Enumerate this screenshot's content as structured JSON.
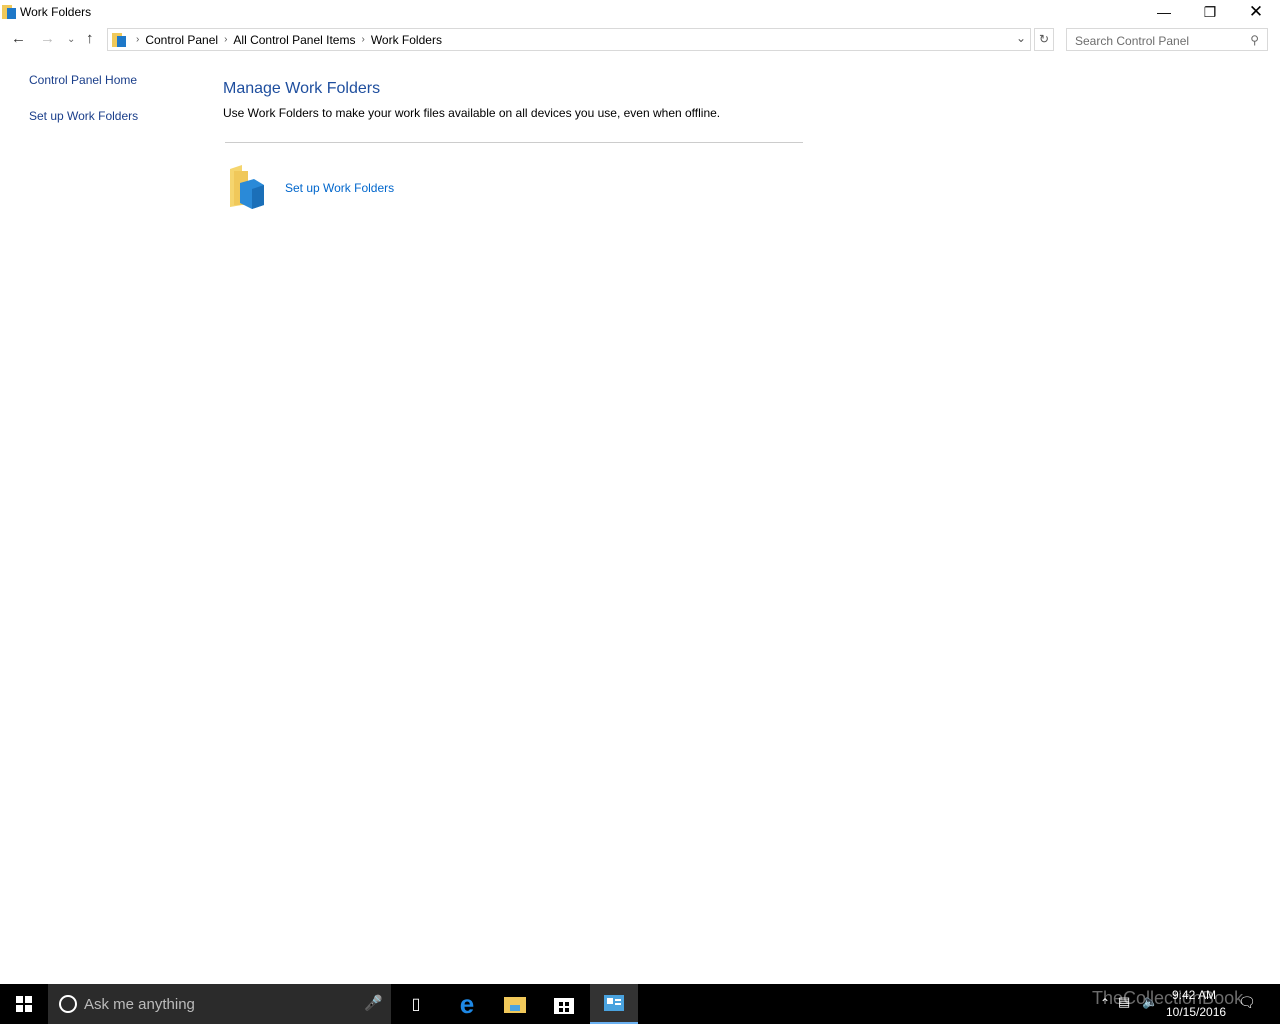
{
  "window": {
    "title": "Work Folders",
    "minimize_icon": "minimize-icon",
    "maximize_icon": "restore-icon",
    "close_icon": "close-icon"
  },
  "address": {
    "crumbs": [
      "Control Panel",
      "All Control Panel Items",
      "Work Folders"
    ],
    "search_placeholder": "Search Control Panel"
  },
  "sidebar": {
    "items": [
      {
        "label": "Control Panel Home"
      },
      {
        "label": "Set up Work Folders"
      }
    ]
  },
  "main": {
    "title": "Manage Work Folders",
    "description": "Use Work Folders to make your work files available on all devices you use, even when offline.",
    "task_label": "Set up Work Folders"
  },
  "taskbar": {
    "search_placeholder": "Ask me anything",
    "time": "9:42 AM",
    "date": "10/15/2016",
    "watermark": "TheCollectionBook"
  },
  "colors": {
    "accent": "#0066cc",
    "heading": "#1e4e9e",
    "taskbar": "#000000"
  }
}
